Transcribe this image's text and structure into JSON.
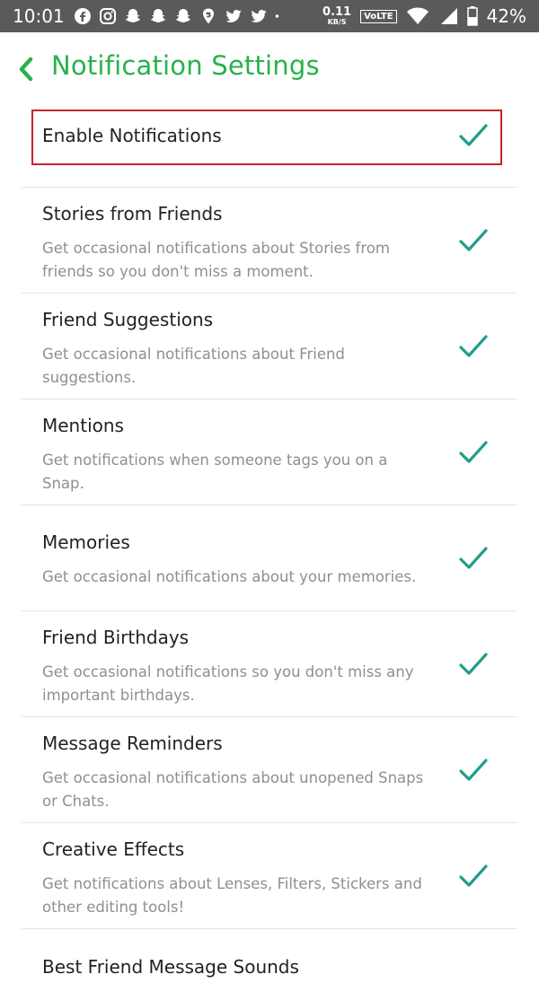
{
  "status_bar": {
    "time": "10:01",
    "notification_icons": [
      "facebook-icon",
      "instagram-icon",
      "snapchat-icon",
      "snapchat-icon",
      "snapchat-icon",
      "swiggy-icon",
      "twitter-icon",
      "twitter-icon",
      "dot-icon"
    ],
    "net_speed_value": "0.11",
    "net_speed_unit": "KB/S",
    "volte": "VoLTE",
    "battery": "42%"
  },
  "header": {
    "title": "Notification Settings",
    "accent_color": "#27b24a"
  },
  "enable": {
    "label": "Enable Notifications",
    "checked": true,
    "highlight_color": "#c8222a"
  },
  "items": [
    {
      "label": "Stories from Friends",
      "desc": "Get occasional notifications about Stories from friends so you don't miss a moment.",
      "checked": true
    },
    {
      "label": "Friend Suggestions",
      "desc": "Get occasional notifications about Friend suggestions.",
      "checked": true
    },
    {
      "label": "Mentions",
      "desc": "Get notifications when someone tags you on a Snap.",
      "checked": true
    },
    {
      "label": "Memories",
      "desc": "Get occasional notifications about your memories.",
      "checked": true
    },
    {
      "label": "Friend Birthdays",
      "desc": "Get occasional notifications so you don't miss any important birthdays.",
      "checked": true
    },
    {
      "label": "Message Reminders",
      "desc": "Get occasional notifications about unopened Snaps or Chats.",
      "checked": true
    },
    {
      "label": "Creative Effects",
      "desc": "Get notifications about Lenses, Filters, Stickers and other editing tools!",
      "checked": true
    }
  ],
  "partial_item": {
    "label": "Best Friend Message Sounds"
  }
}
